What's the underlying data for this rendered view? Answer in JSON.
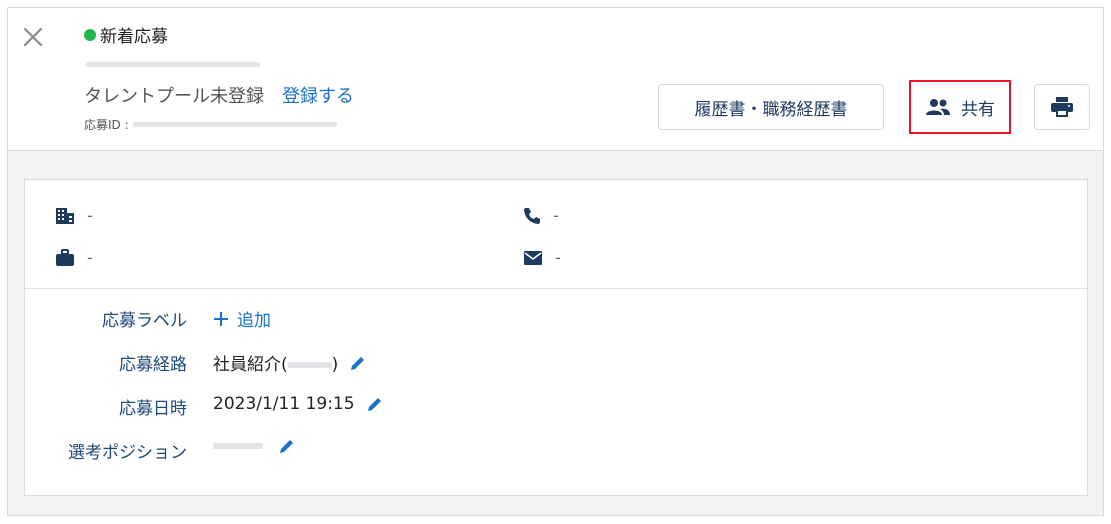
{
  "header": {
    "status": "新着応募",
    "status_color": "#1fb74b",
    "talent_pool_status": "タレントプール未登録",
    "register_link": "登録する",
    "application_id_label": "応募ID :",
    "buttons": {
      "resume": "履歴書・職務経歴書",
      "share": "共有",
      "print_icon": "printer-icon",
      "close_icon": "close-icon"
    }
  },
  "contact": {
    "company": "-",
    "phone": "-",
    "job": "-",
    "email": "-"
  },
  "fields": {
    "label_title": "応募ラベル",
    "label_add": "追加",
    "route_title": "応募経路",
    "route_value_prefix": "社員紹介(",
    "route_value_suffix": ")",
    "datetime_title": "応募日時",
    "datetime_value": "2023/1/11 19:15",
    "position_title": "選考ポジション"
  },
  "colors": {
    "accent": "#1a73c8",
    "label": "#1e4a7a",
    "highlight": "#e8142a"
  }
}
